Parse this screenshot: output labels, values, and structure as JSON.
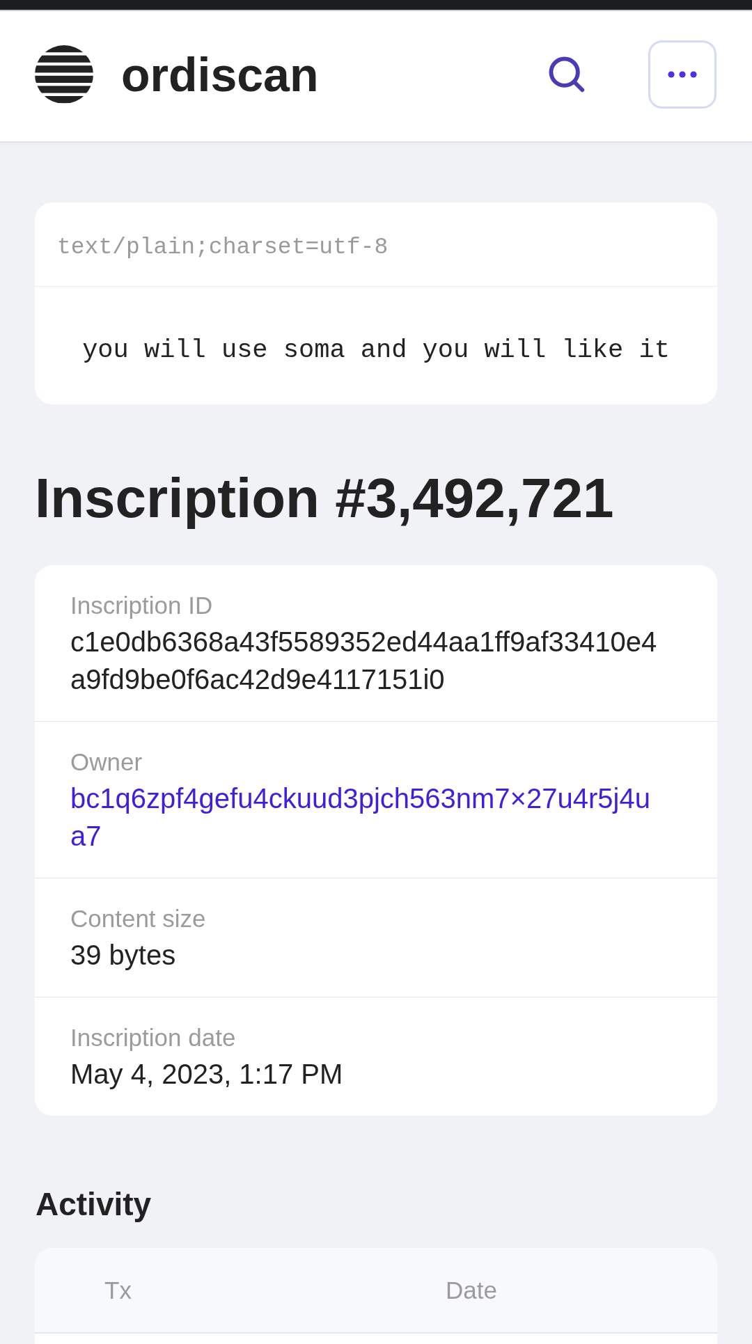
{
  "header": {
    "brand": "ordiscan"
  },
  "preview": {
    "content_type": "text/plain;charset=utf-8",
    "text": "you will use soma and you will like it"
  },
  "title": "Inscription #3,492,721",
  "details": [
    {
      "label": "Inscription ID",
      "value": "c1e0db6368a43f5589352ed44aa1ff9af33410e4a9fd9be0f6ac42d9e4117151i0",
      "kind": "text"
    },
    {
      "label": "Owner",
      "value": "bc1q6zpf4gefu4ckuud3pjch563nm7×27u4r5j4ua7",
      "kind": "link"
    },
    {
      "label": "Content size",
      "value": "39 bytes",
      "kind": "text"
    },
    {
      "label": "Inscription date",
      "value": "May 4, 2023, 1:17 PM",
      "kind": "text"
    }
  ],
  "activity": {
    "title": "Activity",
    "table": {
      "columns": [
        "Tx",
        "Date"
      ]
    }
  }
}
